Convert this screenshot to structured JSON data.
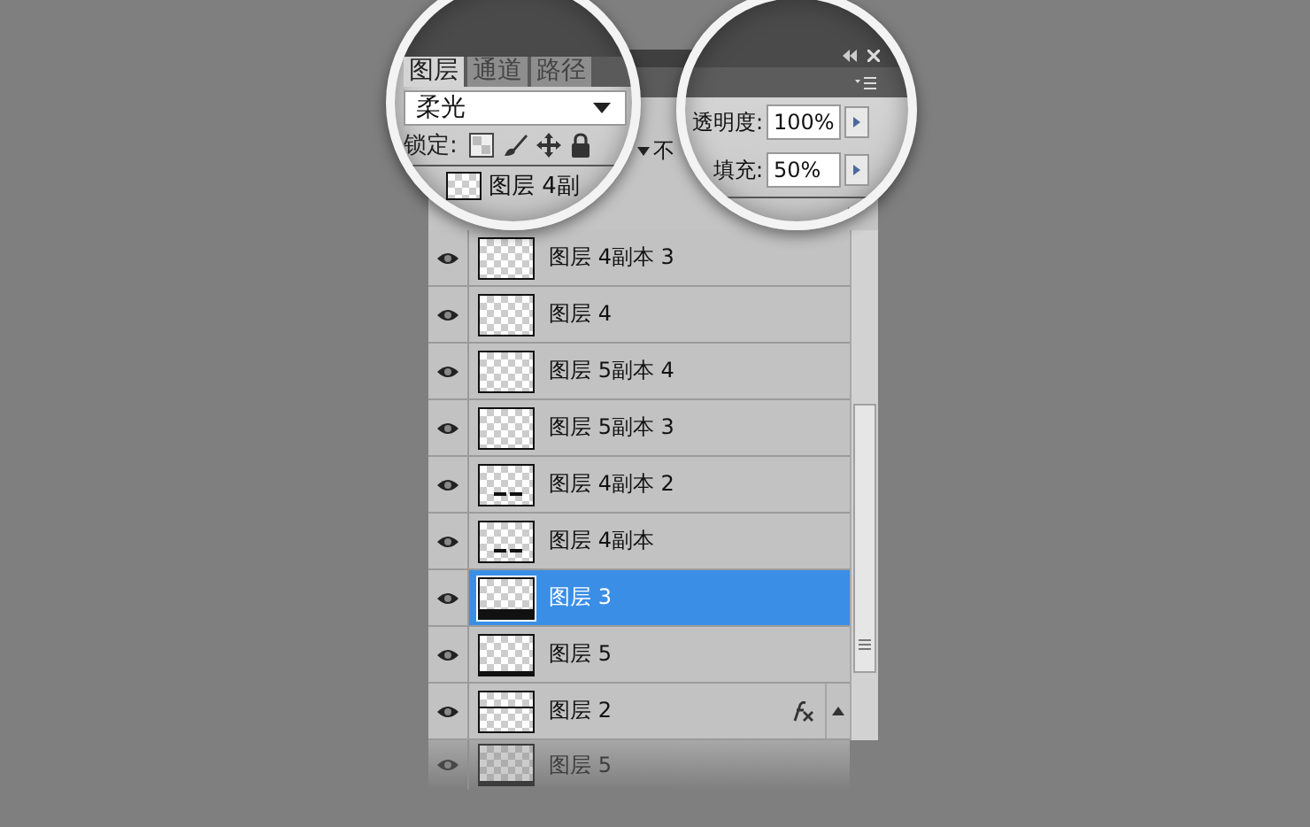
{
  "panel": {
    "tabs": [
      {
        "label": "图层",
        "selected": true
      },
      {
        "label": "通道",
        "selected": false
      },
      {
        "label": "路径",
        "selected": false
      }
    ],
    "blend_mode": "柔光",
    "lock_label": "锁定:",
    "opacity_partial": "不",
    "opacity": {
      "label": "透明度:",
      "value": "100%"
    },
    "fill": {
      "label": "填充:",
      "value": "50%"
    },
    "magnified_layer": {
      "name": "图层 4副",
      "thumbnail": {
        "kind": "plain"
      }
    },
    "layers": [
      {
        "name": "图层 4副本 3",
        "visible": true,
        "selected": false,
        "thumbnail": {
          "kind": "plain"
        },
        "fx": false
      },
      {
        "name": "图层 4",
        "visible": true,
        "selected": false,
        "thumbnail": {
          "kind": "plain"
        },
        "fx": false
      },
      {
        "name": "图层 5副本 4",
        "visible": true,
        "selected": false,
        "thumbnail": {
          "kind": "plain"
        },
        "fx": false
      },
      {
        "name": "图层 5副本 3",
        "visible": true,
        "selected": false,
        "thumbnail": {
          "kind": "plain"
        },
        "fx": false
      },
      {
        "name": "图层 4副本 2",
        "visible": true,
        "selected": false,
        "thumbnail": {
          "kind": "dashes"
        },
        "fx": false
      },
      {
        "name": "图层 4副本",
        "visible": true,
        "selected": false,
        "thumbnail": {
          "kind": "dashes"
        },
        "fx": false
      },
      {
        "name": "图层 3",
        "visible": true,
        "selected": true,
        "thumbnail": {
          "kind": "bar"
        },
        "fx": false
      },
      {
        "name": "图层 5",
        "visible": true,
        "selected": false,
        "thumbnail": {
          "kind": "underline"
        },
        "fx": false
      },
      {
        "name": "图层 2",
        "visible": true,
        "selected": false,
        "thumbnail": {
          "kind": "rule"
        },
        "fx": true
      }
    ],
    "reflection": {
      "name": "图层 5",
      "thumbnail": {
        "kind": "underline"
      }
    }
  }
}
